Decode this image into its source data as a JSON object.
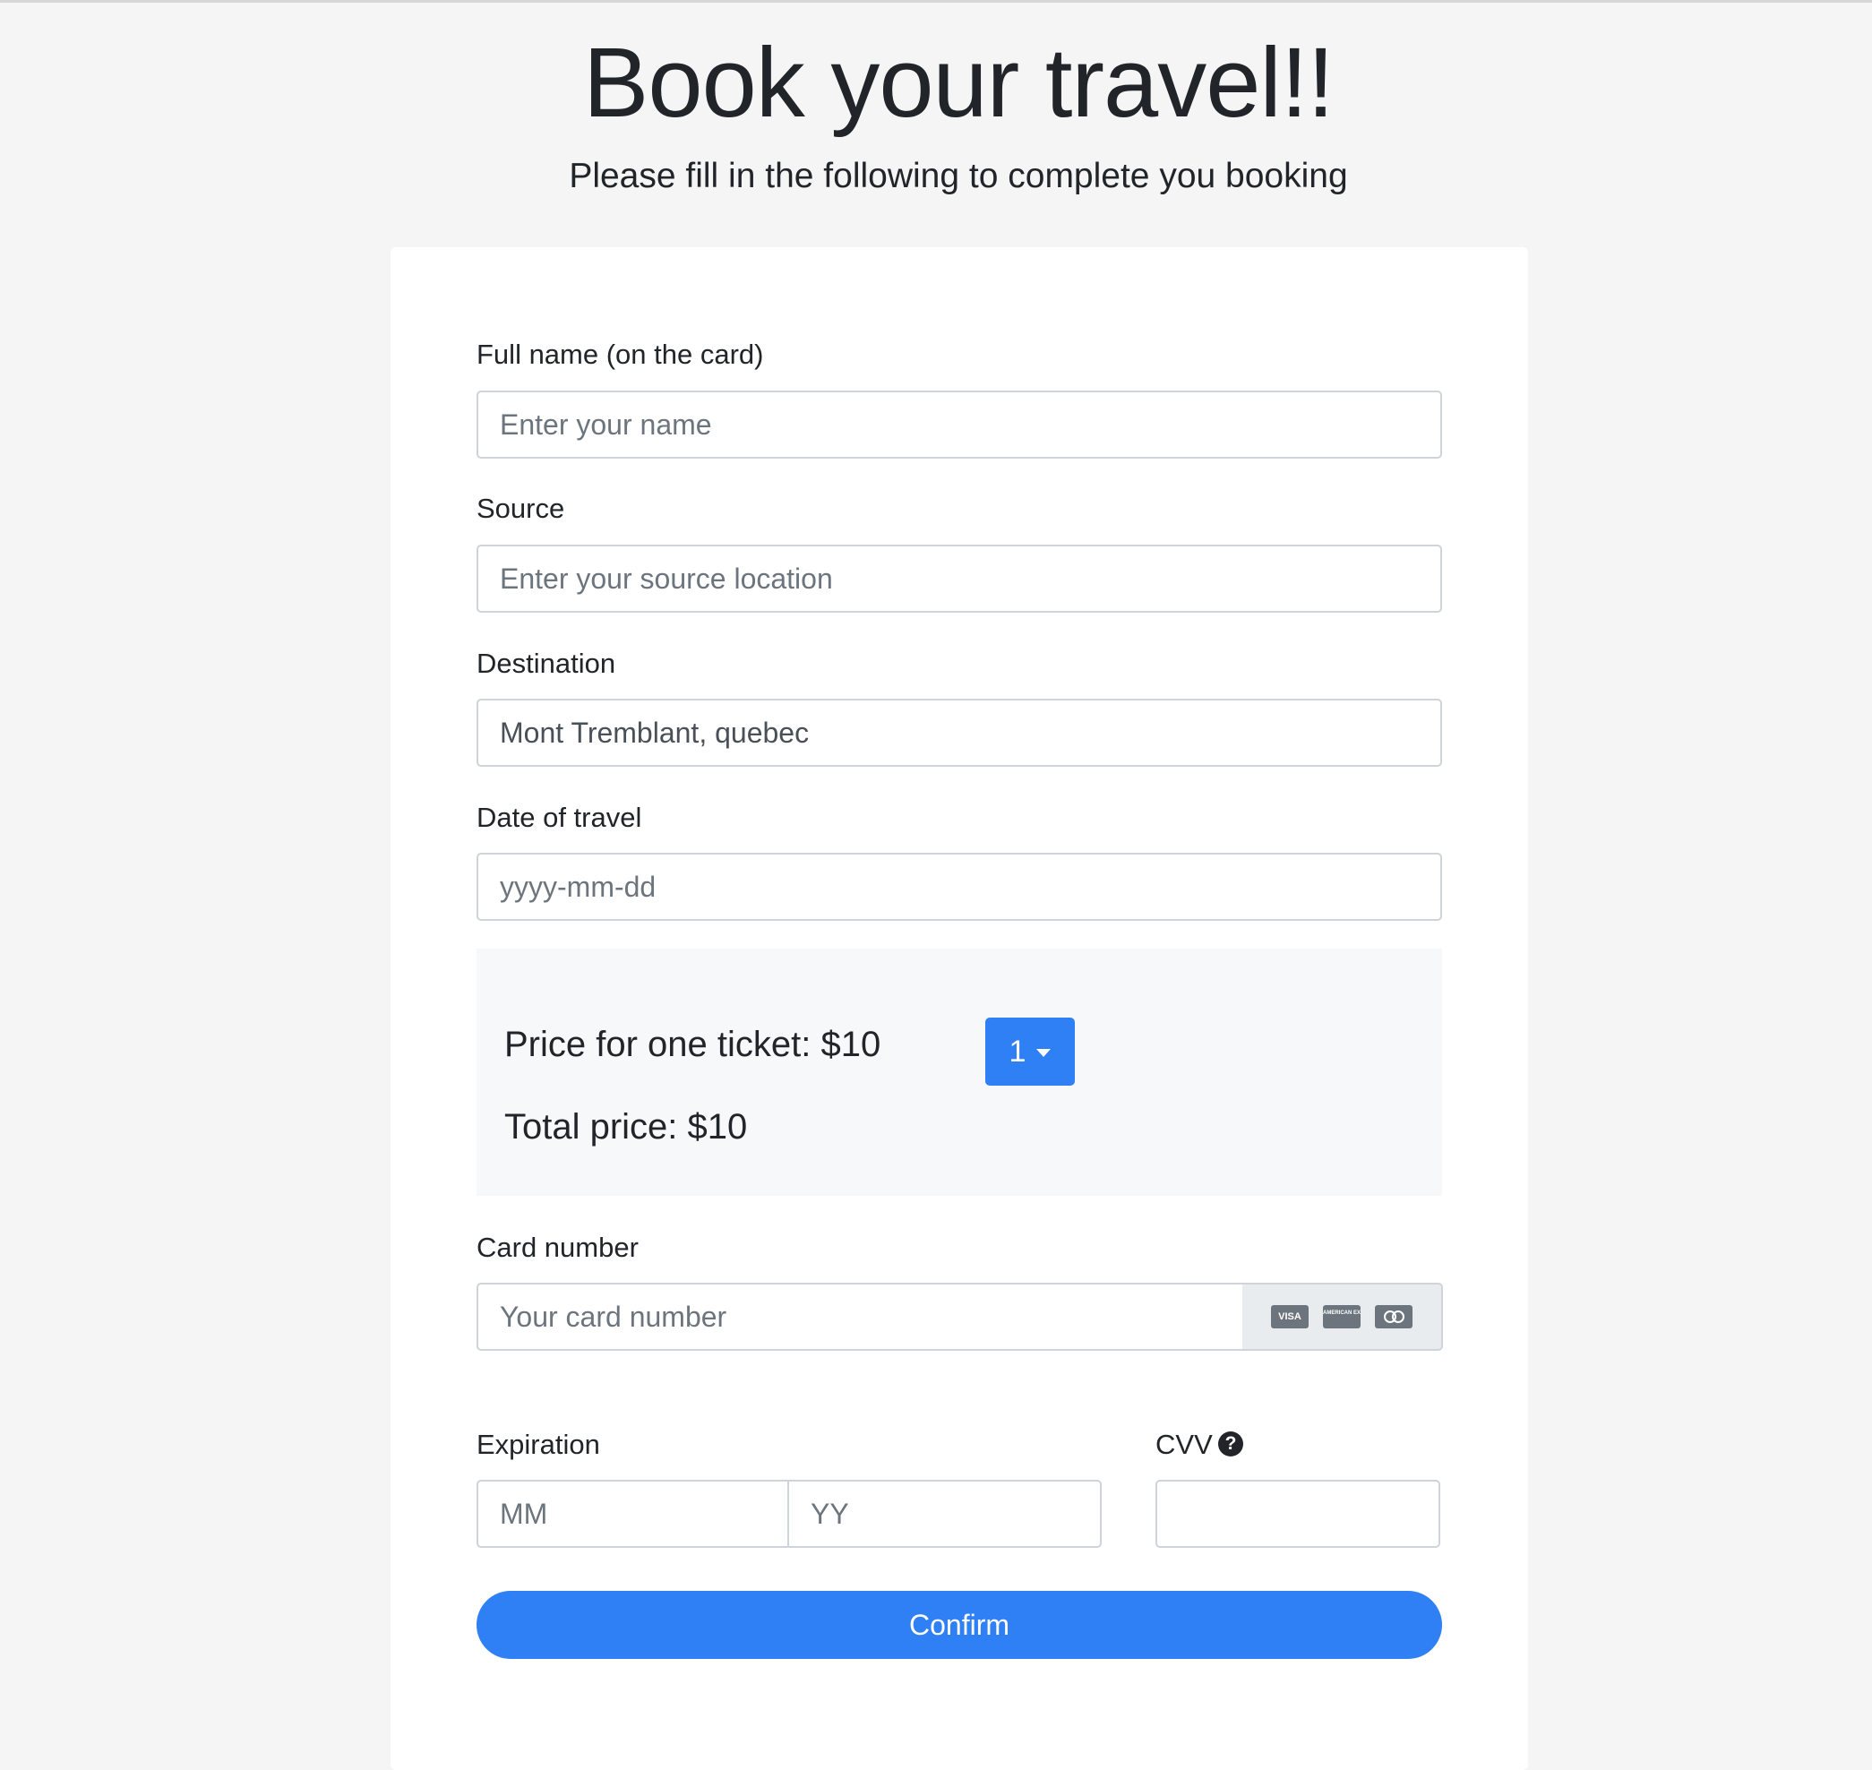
{
  "header": {
    "title": "Book your travel!!",
    "subtitle": "Please fill in the following to complete you booking"
  },
  "form": {
    "full_name": {
      "label": "Full name (on the card)",
      "placeholder": "Enter your name",
      "value": ""
    },
    "source": {
      "label": "Source",
      "placeholder": "Enter your source location",
      "value": ""
    },
    "destination": {
      "label": "Destination",
      "placeholder": "",
      "value": "Mont Tremblant, quebec"
    },
    "date_of_travel": {
      "label": "Date of travel",
      "placeholder": "yyyy-mm-dd",
      "value": ""
    },
    "pricing": {
      "price_text": "Price for one ticket: $10",
      "total_text": "Total price: $10",
      "quantity": "1"
    },
    "card_number": {
      "label": "Card number",
      "placeholder": "Your card number",
      "value": ""
    },
    "card_brands": [
      {
        "name": "visa-icon",
        "text": "VISA"
      },
      {
        "name": "amex-icon",
        "text": "AMERICAN EXPRESS"
      },
      {
        "name": "mastercard-icon",
        "text": ""
      }
    ],
    "expiration": {
      "label": "Expiration",
      "month_placeholder": "MM",
      "year_placeholder": "YY"
    },
    "cvv": {
      "label": "CVV",
      "placeholder": "",
      "help_icon": "question-circle-icon"
    },
    "confirm_label": "Confirm"
  },
  "colors": {
    "primary": "#2f80f5",
    "background": "#f5f5f5",
    "card": "#ffffff",
    "panel": "#f7f8fa"
  }
}
